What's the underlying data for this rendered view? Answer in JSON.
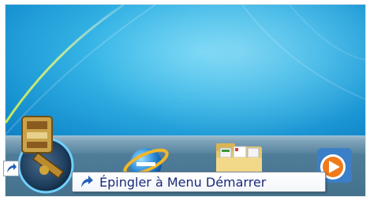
{
  "taskbar": {
    "pinned_items": [
      {
        "name": "internet-explorer"
      },
      {
        "name": "windows-explorer"
      },
      {
        "name": "windows-media-player"
      }
    ]
  },
  "drag_item": {
    "icon": "media-app-icon"
  },
  "tooltip": {
    "label": "Épingler à Menu Démarrer"
  }
}
